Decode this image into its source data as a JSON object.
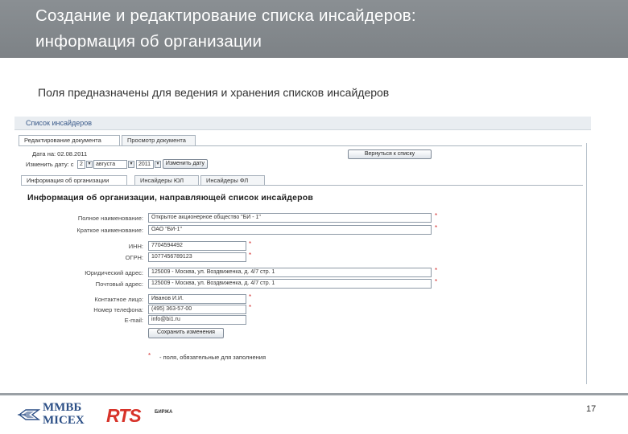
{
  "slide": {
    "title_line_1": "Создание  и редактирование списка инсайдеров:",
    "title_line_2": "информация об организации",
    "subtitle": "Поля предназначены для ведения и хранения списков инсайдеров",
    "page_number": "17"
  },
  "app": {
    "header": "Список инсайдеров",
    "top_tabs": [
      "Редактирование документа",
      "Просмотр документа"
    ],
    "date_label": "Дата на: 02.08.2011",
    "change_date_label": "Изменить дату: с",
    "day_value": "2",
    "month_value": "августа",
    "year_value": "2011",
    "change_date_button": "Изменить дату",
    "save_button": "Вернуться к списку",
    "sub_tabs": [
      "Информация об организации",
      "Инсайдеры ЮЛ",
      "Инсайдеры ФЛ"
    ],
    "section_heading": "Информация об организации, направляющей список инсайдеров",
    "fields": [
      {
        "label": "Полное наименование:",
        "value": "Открытое акционерное общество \"БИ - 1\"",
        "required": true
      },
      {
        "label": "Краткое наименование:",
        "value": "ОАО \"БИ-1\"",
        "required": true
      },
      {
        "label": "ИНН:",
        "value": "7704594492",
        "required": true
      },
      {
        "label": "ОГРН:",
        "value": "1077456789123",
        "required": true
      },
      {
        "label": "Юридический адрес:",
        "value": "125009 - Москва, ул. Воздвиженка, д. 4/7 стр. 1",
        "required": true
      },
      {
        "label": "Почтовый адрес:",
        "value": "125009 - Москва, ул. Воздвиженка, д. 4/7 стр. 1",
        "required": true
      },
      {
        "label": "Контактное лицо:",
        "value": "Иванов И.И.",
        "required": true
      },
      {
        "label": "Номер телефона:",
        "value": "(495) 363-57-00",
        "required": true
      },
      {
        "label": "E-mail:",
        "value": "info@bi1.ru",
        "required": false
      }
    ],
    "submit_button": "Сохранить изменения",
    "required_note": "- поля, обязательные для заполнения"
  },
  "logos": {
    "micex_line_1": "ММВБ",
    "micex_line_2": "MICEX",
    "rts": "RTS",
    "rts_sub": "БИРЖА"
  },
  "colors": {
    "title_band": "#8a8f93",
    "required_star": "#d12a2a",
    "micex_blue": "#2c4f86",
    "rts_red": "#d7332a"
  }
}
